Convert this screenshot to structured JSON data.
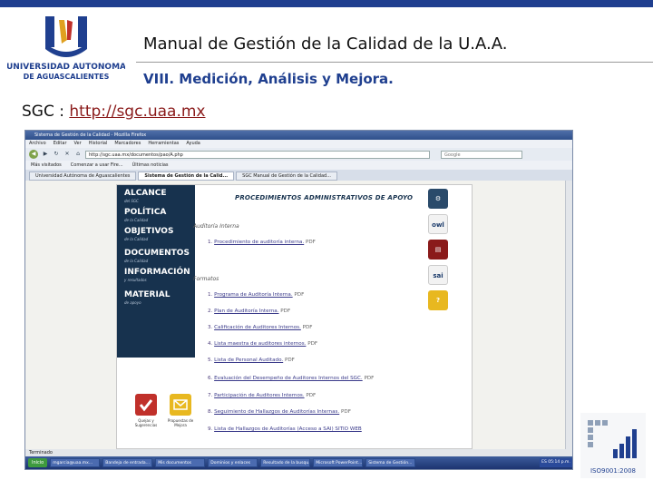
{
  "slide": {
    "title": "Manual de Gestión de la Calidad de la U.A.A.",
    "subtitle": "VIII. Medición, Análisis y Mejora.",
    "sgc_label": "SGC :",
    "sgc_link": "http://sgc.uaa.mx",
    "logo": {
      "line1": "UNIVERSIDAD AUTONOMA",
      "line2": "DE AGUASCALIENTES"
    },
    "iso_badge": "ISO9001:2008",
    "colors": {
      "brand_blue": "#1f3f8f",
      "nav_dark": "#17324e",
      "link": "#8a1a1a"
    }
  },
  "browser": {
    "window_title": "Sistema de Gestión de la Calidad - Mozilla Firefox",
    "menu": [
      "Archivo",
      "Editar",
      "Ver",
      "Historial",
      "Marcadores",
      "Herramientas",
      "Ayuda"
    ],
    "url": "http://sgc.uaa.mx/documentos/pao/A.php",
    "search_placeholder": "Google",
    "bookmarks": [
      "Más visitados",
      "Comenzar a usar Fire...",
      "Últimas noticias"
    ],
    "tabs": [
      {
        "label": "Universidad Autónoma de Aguascalientes",
        "active": false
      },
      {
        "label": "Sistema de Gestión de la Calid...",
        "active": true
      },
      {
        "label": "SGC Manual de Gestión de la Calidad...",
        "active": false
      }
    ],
    "status": "Terminado",
    "taskbar": {
      "start": "Inicio",
      "items": [
        "mgarcia@uaa.mx...",
        "Bandeja de entrada...",
        "Mis documentos",
        "Dominios y enlaces",
        "Resultado de la busqu...",
        "Microsoft PowerPoint...",
        "Sistema de Gestión..."
      ],
      "clock": "ES 05:14 p.m."
    }
  },
  "site": {
    "header": "PROCEDIMIENTOS ADMINISTRATIVOS DE APOYO",
    "nav": [
      {
        "label": "ALCANCE",
        "sub": "del SGC"
      },
      {
        "label": "POLÍTICA",
        "sub": "de la Calidad"
      },
      {
        "label": "OBJETIVOS",
        "sub": "de la Calidad"
      },
      {
        "label": "DOCUMENTOS",
        "sub": "de la Calidad"
      },
      {
        "label": "INFORMACIÓN",
        "sub": "y resultados"
      },
      {
        "label": "MATERIAL",
        "sub": "de apoyo"
      }
    ],
    "quick": [
      {
        "label": "Quejas y Sugerencias"
      },
      {
        "label": "Propuestas de Mejora"
      }
    ],
    "section1": "Auditoría Interna",
    "procedures": [
      {
        "num": "1.",
        "text": "Procedimiento de auditoría interna.",
        "fmt": "PDF"
      }
    ],
    "section2": "Formatos",
    "formats": [
      {
        "num": "1.",
        "text": "Programa de Auditoría Interna.",
        "fmt": "PDF"
      },
      {
        "num": "2.",
        "text": "Plan de Auditoría Interna.",
        "fmt": "PDF"
      },
      {
        "num": "3.",
        "text": "Calificación de Auditores Internos.",
        "fmt": "PDF"
      },
      {
        "num": "4.",
        "text": "Lista maestra de auditores internos.",
        "fmt": "PDF"
      },
      {
        "num": "5.",
        "text": "Lista de Personal Auditado.",
        "fmt": "PDF"
      },
      {
        "num": "6.",
        "text": "Evaluación del Desempeño de Auditores Internos del SGC.",
        "fmt": "PDF"
      },
      {
        "num": "7.",
        "text": "Participación de Auditores Internos.",
        "fmt": "PDF"
      },
      {
        "num": "8.",
        "text": "Seguimiento de Hallazgos de Auditorías Internas.",
        "fmt": "PDF"
      },
      {
        "num": "9.",
        "text": "Lista de Hallazgos de Auditorías (Acceso a SAI) SITIO WEB",
        "fmt": ""
      }
    ],
    "side_icons": [
      "owl",
      "sai"
    ]
  }
}
